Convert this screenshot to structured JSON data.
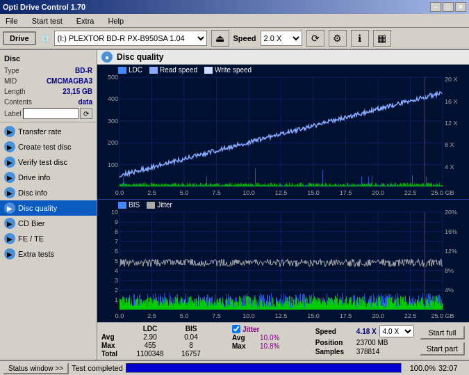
{
  "titleBar": {
    "title": "Opti Drive Control 1.70",
    "minimize": "─",
    "maximize": "□",
    "close": "✕"
  },
  "menu": {
    "items": [
      "File",
      "Start test",
      "Extra",
      "Help"
    ]
  },
  "driveBar": {
    "driveLabel": "Drive",
    "driveValue": "(I:)  PLEXTOR BD-R  PX-B950SA 1.04",
    "speedLabel": "Speed",
    "speedValue": "2.0 X"
  },
  "sidebar": {
    "discSectionLabel": "Disc",
    "discInfo": {
      "typeLabel": "Type",
      "typeValue": "BD-R",
      "midLabel": "MID",
      "midValue": "CMCMAGBA3",
      "lengthLabel": "Length",
      "lengthValue": "23,15 GB",
      "contentsLabel": "Contents",
      "contentsValue": "data",
      "labelLabel": "Label"
    },
    "navItems": [
      {
        "id": "transfer-rate",
        "label": "Transfer rate",
        "iconType": "blue"
      },
      {
        "id": "create-test-disc",
        "label": "Create test disc",
        "iconType": "blue"
      },
      {
        "id": "verify-test-disc",
        "label": "Verify test disc",
        "iconType": "blue"
      },
      {
        "id": "drive-info",
        "label": "Drive info",
        "iconType": "blue"
      },
      {
        "id": "disc-info",
        "label": "Disc info",
        "iconType": "blue"
      },
      {
        "id": "disc-quality",
        "label": "Disc quality",
        "iconType": "blue",
        "active": true
      },
      {
        "id": "cd-bier",
        "label": "CD Bier",
        "iconType": "blue"
      },
      {
        "id": "fe-te",
        "label": "FE / TE",
        "iconType": "blue"
      },
      {
        "id": "extra-tests",
        "label": "Extra tests",
        "iconType": "blue"
      }
    ]
  },
  "contentHeader": {
    "title": "Disc quality",
    "legend1": "LDC",
    "legend2": "Read speed",
    "legend3": "Write speed",
    "legend4": "BIS",
    "legend5": "Jitter"
  },
  "chart1": {
    "yMax": 500,
    "yLabels": [
      "500",
      "400",
      "300",
      "200",
      "100"
    ],
    "yRightLabels": [
      "20 X",
      "16 X",
      "12 X",
      "8 X",
      "4 X"
    ],
    "xLabels": [
      "0.0",
      "2.5",
      "5.0",
      "7.5",
      "10.0",
      "12.5",
      "15.0",
      "17.5",
      "20.0",
      "22.5",
      "25.0 GB"
    ]
  },
  "chart2": {
    "yLabels": [
      "10",
      "9",
      "8",
      "7",
      "6",
      "5",
      "4",
      "3",
      "2",
      "1"
    ],
    "yRightLabels": [
      "20%",
      "16%",
      "12%",
      "8%",
      "4%"
    ],
    "xLabels": [
      "0.0",
      "2.5",
      "5.0",
      "7.5",
      "10.0",
      "12.5",
      "15.0",
      "17.5",
      "20.0",
      "22.5",
      "25.0 GB"
    ]
  },
  "statsBottom": {
    "avgLabel": "Avg",
    "maxLabel": "Max",
    "totalLabel": "Total",
    "ldcAvg": "2.90",
    "ldcMax": "455",
    "ldcTotal": "1100348",
    "bisAvg": "0.04",
    "bisMax": "8",
    "bisTotal": "16757",
    "jitterChecked": true,
    "jitterLabel": "Jitter",
    "jitterAvg": "10.0%",
    "jitterMax": "10.8%",
    "speedLabel": "Speed",
    "speedValue": "4.18 X",
    "speedDropdown": "4.0 X",
    "positionLabel": "Position",
    "positionValue": "23700 MB",
    "samplesLabel": "Samples",
    "samplesValue": "378814",
    "startFullBtn": "Start full",
    "startPartBtn": "Start part"
  },
  "statusBar": {
    "windowBtn": "Status window >>",
    "statusText": "Test completed",
    "progressPct": "100.0%",
    "time": "32:07"
  }
}
